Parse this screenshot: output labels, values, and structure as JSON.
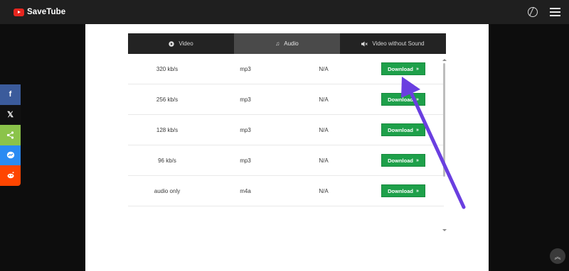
{
  "header": {
    "brand": "SaveTube"
  },
  "tabs": [
    {
      "label": "Video",
      "icon": "play-circle-icon",
      "active": false
    },
    {
      "label": "Audio",
      "icon": "music-note-icon",
      "active": true
    },
    {
      "label": "Video without Sound",
      "icon": "speaker-mute-icon",
      "active": false
    }
  ],
  "rows": [
    {
      "quality": "320 kb/s",
      "format": "mp3",
      "size": "N/A",
      "button": "Download"
    },
    {
      "quality": "256 kb/s",
      "format": "mp3",
      "size": "N/A",
      "button": "Download"
    },
    {
      "quality": "128 kb/s",
      "format": "mp3",
      "size": "N/A",
      "button": "Download"
    },
    {
      "quality": "96 kb/s",
      "format": "mp3",
      "size": "N/A",
      "button": "Download"
    },
    {
      "quality": "audio only",
      "format": "m4a",
      "size": "N/A",
      "button": "Download"
    }
  ],
  "social": [
    {
      "name": "facebook",
      "glyph": "f"
    },
    {
      "name": "x",
      "glyph": "𝕏"
    },
    {
      "name": "share",
      "glyph": "⋖"
    },
    {
      "name": "messenger",
      "glyph": "✉"
    },
    {
      "name": "reddit",
      "glyph": "●"
    }
  ],
  "colors": {
    "download_green": "#1ea04a",
    "annotation_arrow": "#6a3fe0",
    "brand_red": "#e6261f"
  }
}
